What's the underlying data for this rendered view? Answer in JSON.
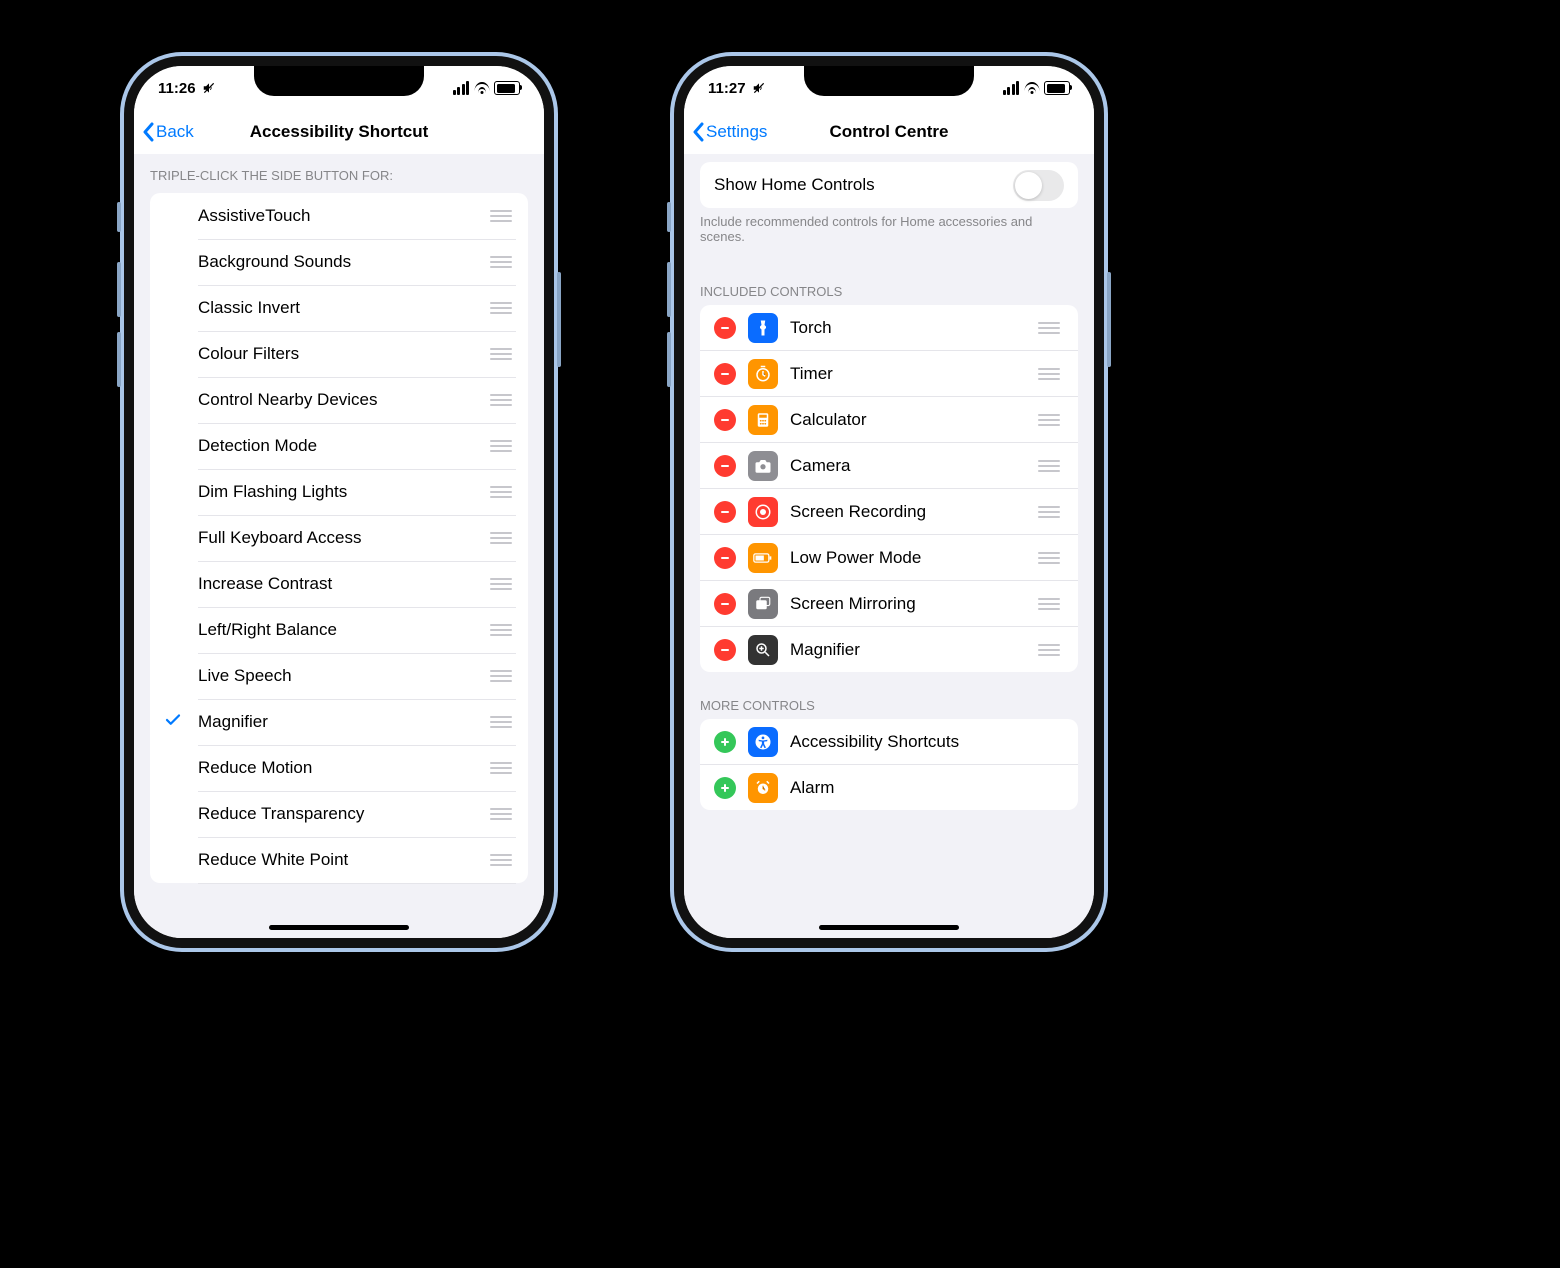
{
  "phone1": {
    "status_time": "11:26",
    "nav_back": "Back",
    "nav_title": "Accessibility Shortcut",
    "section_header": "TRIPLE-CLICK THE SIDE BUTTON FOR:",
    "items": [
      {
        "label": "AssistiveTouch",
        "checked": false
      },
      {
        "label": "Background Sounds",
        "checked": false
      },
      {
        "label": "Classic Invert",
        "checked": false
      },
      {
        "label": "Colour Filters",
        "checked": false
      },
      {
        "label": "Control Nearby Devices",
        "checked": false
      },
      {
        "label": "Detection Mode",
        "checked": false
      },
      {
        "label": "Dim Flashing Lights",
        "checked": false
      },
      {
        "label": "Full Keyboard Access",
        "checked": false
      },
      {
        "label": "Increase Contrast",
        "checked": false
      },
      {
        "label": "Left/Right Balance",
        "checked": false
      },
      {
        "label": "Live Speech",
        "checked": false
      },
      {
        "label": "Magnifier",
        "checked": true
      },
      {
        "label": "Reduce Motion",
        "checked": false
      },
      {
        "label": "Reduce Transparency",
        "checked": false
      },
      {
        "label": "Reduce White Point",
        "checked": false
      }
    ]
  },
  "phone2": {
    "status_time": "11:27",
    "nav_back": "Settings",
    "nav_title": "Control Centre",
    "home_row_label": "Show Home Controls",
    "home_row_on": false,
    "home_footer": "Include recommended controls for Home accessories and scenes.",
    "included_header": "INCLUDED CONTROLS",
    "included": [
      {
        "label": "Torch",
        "icon": "torch",
        "bg": "#0a6cff"
      },
      {
        "label": "Timer",
        "icon": "timer",
        "bg": "#ff9500"
      },
      {
        "label": "Calculator",
        "icon": "calculator",
        "bg": "#ff9500"
      },
      {
        "label": "Camera",
        "icon": "camera",
        "bg": "#8e8e93"
      },
      {
        "label": "Screen Recording",
        "icon": "record",
        "bg": "#ff3b30"
      },
      {
        "label": "Low Power Mode",
        "icon": "battery",
        "bg": "#ff9500"
      },
      {
        "label": "Screen Mirroring",
        "icon": "mirror",
        "bg": "#7a7a7e"
      },
      {
        "label": "Magnifier",
        "icon": "magnifier",
        "bg": "#333333"
      }
    ],
    "more_header": "MORE CONTROLS",
    "more": [
      {
        "label": "Accessibility Shortcuts",
        "icon": "accessibility",
        "bg": "#0a6cff"
      },
      {
        "label": "Alarm",
        "icon": "alarm",
        "bg": "#ff9500"
      }
    ]
  }
}
